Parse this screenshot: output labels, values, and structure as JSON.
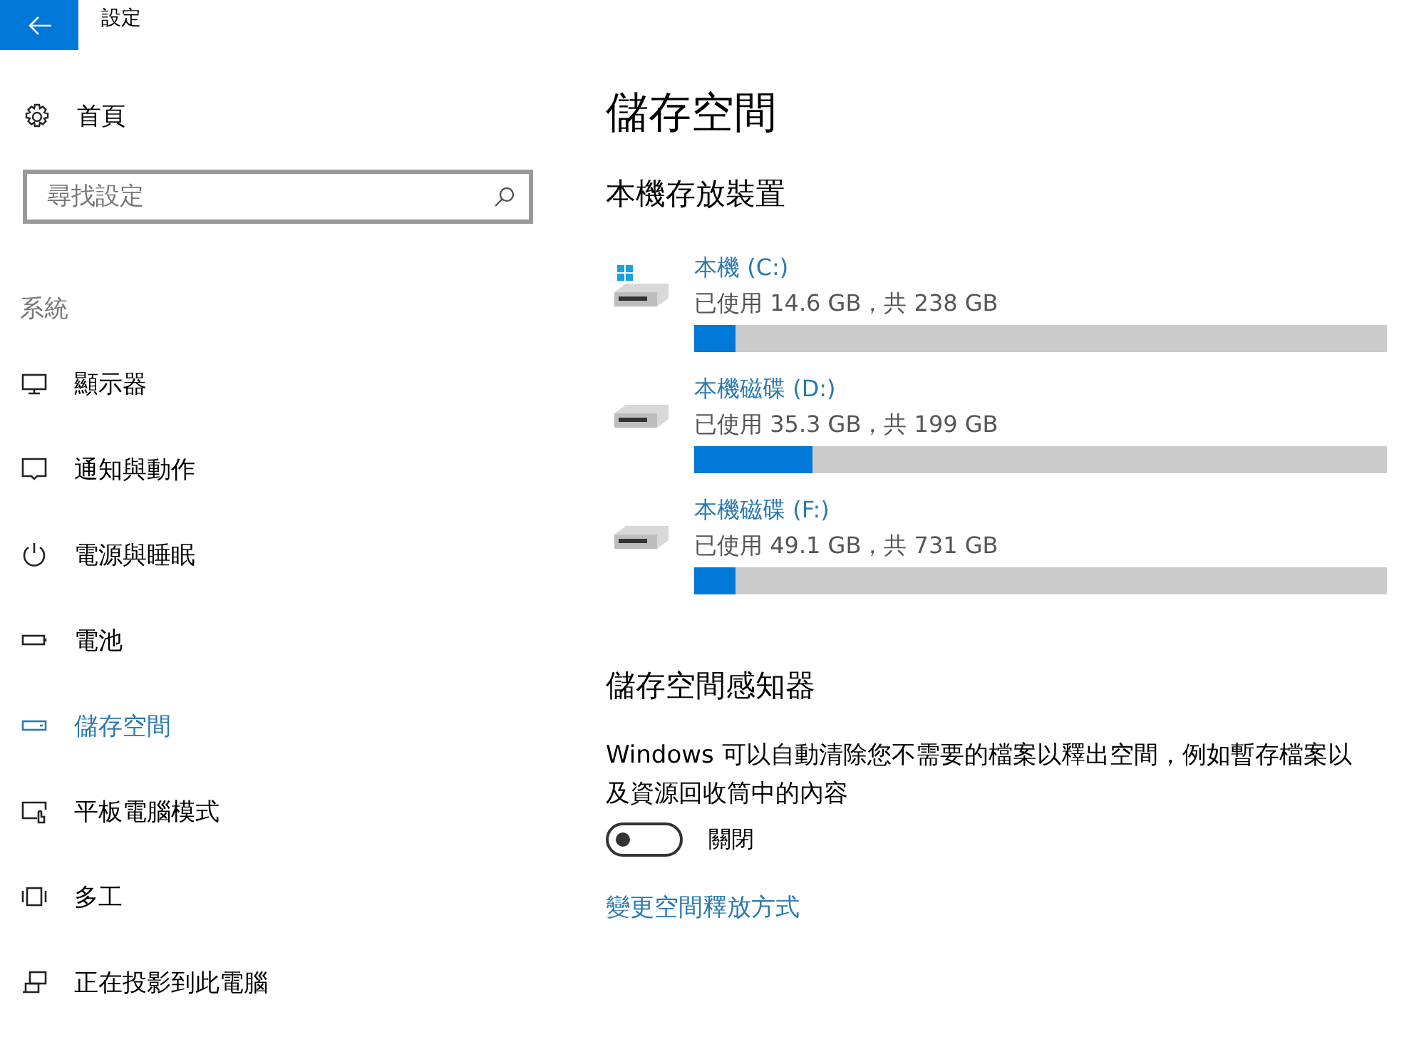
{
  "window": {
    "title": "設定"
  },
  "sidebar": {
    "home": "首頁",
    "search": {
      "placeholder": "尋找設定"
    },
    "section": "系統",
    "items": [
      {
        "label": "顯示器",
        "kind": "display",
        "selected": false
      },
      {
        "label": "通知與動作",
        "kind": "notifications",
        "selected": false
      },
      {
        "label": "電源與睡眠",
        "kind": "power",
        "selected": false
      },
      {
        "label": "電池",
        "kind": "battery",
        "selected": false
      },
      {
        "label": "儲存空間",
        "kind": "storage",
        "selected": true
      },
      {
        "label": "平板電腦模式",
        "kind": "tablet",
        "selected": false
      },
      {
        "label": "多工",
        "kind": "multitask",
        "selected": false
      },
      {
        "label": "正在投影到此電腦",
        "kind": "project",
        "selected": false
      }
    ]
  },
  "main": {
    "title": "儲存空間",
    "drives_heading": "本機存放裝置",
    "drives": [
      {
        "name": "本機 (C:)",
        "kind": "system",
        "usage": "已使用 14.6 GB，共 238 GB",
        "level": 0.06
      },
      {
        "name": "本機磁碟 (D:)",
        "kind": "data",
        "usage": "已使用 35.3 GB，共 199 GB",
        "level": 0.17
      },
      {
        "name": "本機磁碟 (F:)",
        "kind": "data",
        "usage": "已使用 49.1 GB，共 731 GB",
        "level": 0.06
      }
    ],
    "sense": {
      "heading": "儲存空間感知器",
      "description": "Windows 可以自動清除您不需要的檔案以釋出空間，例如暫存檔案以及資源回收筒中的內容",
      "toggle": {
        "on": false,
        "label": "關閉"
      },
      "link": "變更空間釋放方式"
    }
  }
}
